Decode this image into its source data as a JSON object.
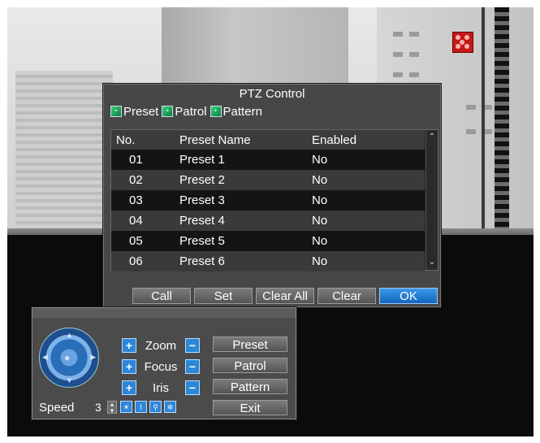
{
  "colors": {
    "accent": "#2e86d8",
    "ok_button": "#1565c0",
    "dialog_bg": "#474747",
    "record_indicator": "#c41818"
  },
  "dialog": {
    "title": "PTZ Control",
    "tabs": [
      {
        "label": "Preset",
        "icon": "preset-tab-icon",
        "active": true
      },
      {
        "label": "Patrol",
        "icon": "patrol-tab-icon",
        "active": false
      },
      {
        "label": "Pattern",
        "icon": "pattern-tab-icon",
        "active": false
      }
    ],
    "table": {
      "columns": [
        "No.",
        "Preset Name",
        "Enabled"
      ],
      "rows": [
        {
          "no": "01",
          "name": "Preset 1",
          "enabled": "No"
        },
        {
          "no": "02",
          "name": "Preset 2",
          "enabled": "No"
        },
        {
          "no": "03",
          "name": "Preset 3",
          "enabled": "No"
        },
        {
          "no": "04",
          "name": "Preset 4",
          "enabled": "No"
        },
        {
          "no": "05",
          "name": "Preset 5",
          "enabled": "No"
        },
        {
          "no": "06",
          "name": "Preset 6",
          "enabled": "No"
        }
      ]
    },
    "buttons": {
      "call": "Call",
      "set": "Set",
      "clear_all": "Clear All",
      "clear": "Clear",
      "ok": "OK"
    }
  },
  "panel": {
    "controls": {
      "zoom": "Zoom",
      "focus": "Focus",
      "iris": "Iris"
    },
    "side_buttons": {
      "preset": "Preset",
      "patrol": "Patrol",
      "pattern": "Pattern",
      "exit": "Exit"
    },
    "speed_label": "Speed",
    "speed_value": "3",
    "icons": [
      "light-icon",
      "wiper-icon",
      "zoom-3d-icon",
      "auto-scan-icon"
    ]
  },
  "camera": {
    "record_icon": "record-indicator-icon"
  }
}
